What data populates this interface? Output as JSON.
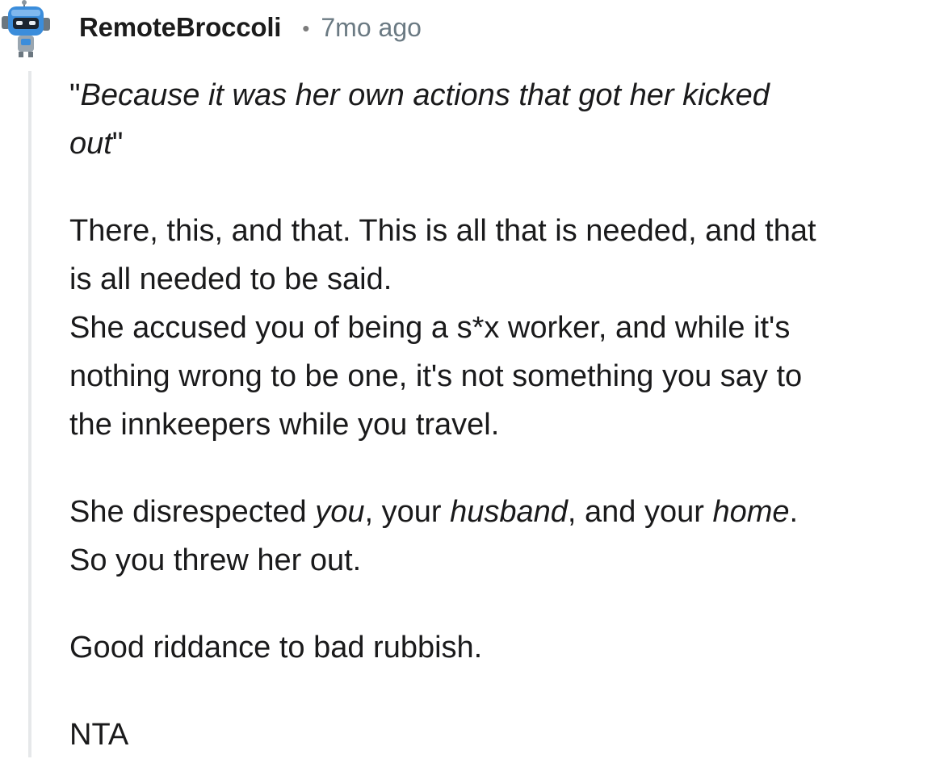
{
  "comment": {
    "author": "RemoteBroccoli",
    "separator": "•",
    "timestamp": "7mo ago",
    "avatar_icon": "robot-avatar-icon",
    "quote": {
      "open": "\"",
      "text_line1": "Because it was her own actions that got her kicked",
      "text_line2": "out",
      "close": "\""
    },
    "paragraph1": {
      "line1": "There, this, and that. This is all that is needed, and that",
      "line2": "is all needed to be said.",
      "line3": "She accused you of being a s*x worker, and while it's",
      "line4": "nothing wrong to be one, it's not something you say to",
      "line5": "the innkeepers while you travel."
    },
    "paragraph2": {
      "part1": "She disrespected ",
      "em1": "you",
      "part2": ", your ",
      "em2": "husband",
      "part3": ", and your ",
      "em3": "home",
      "part4": ".",
      "line2": "So you threw her out."
    },
    "paragraph3": "Good riddance to bad rubbish.",
    "paragraph4": "NTA"
  },
  "colors": {
    "username": "#1c1c1c",
    "timestamp": "#6b7a83",
    "thread_line": "#e6e8ea",
    "body_text": "#1a1a1b",
    "avatar_blue": "#3b8ddb"
  }
}
